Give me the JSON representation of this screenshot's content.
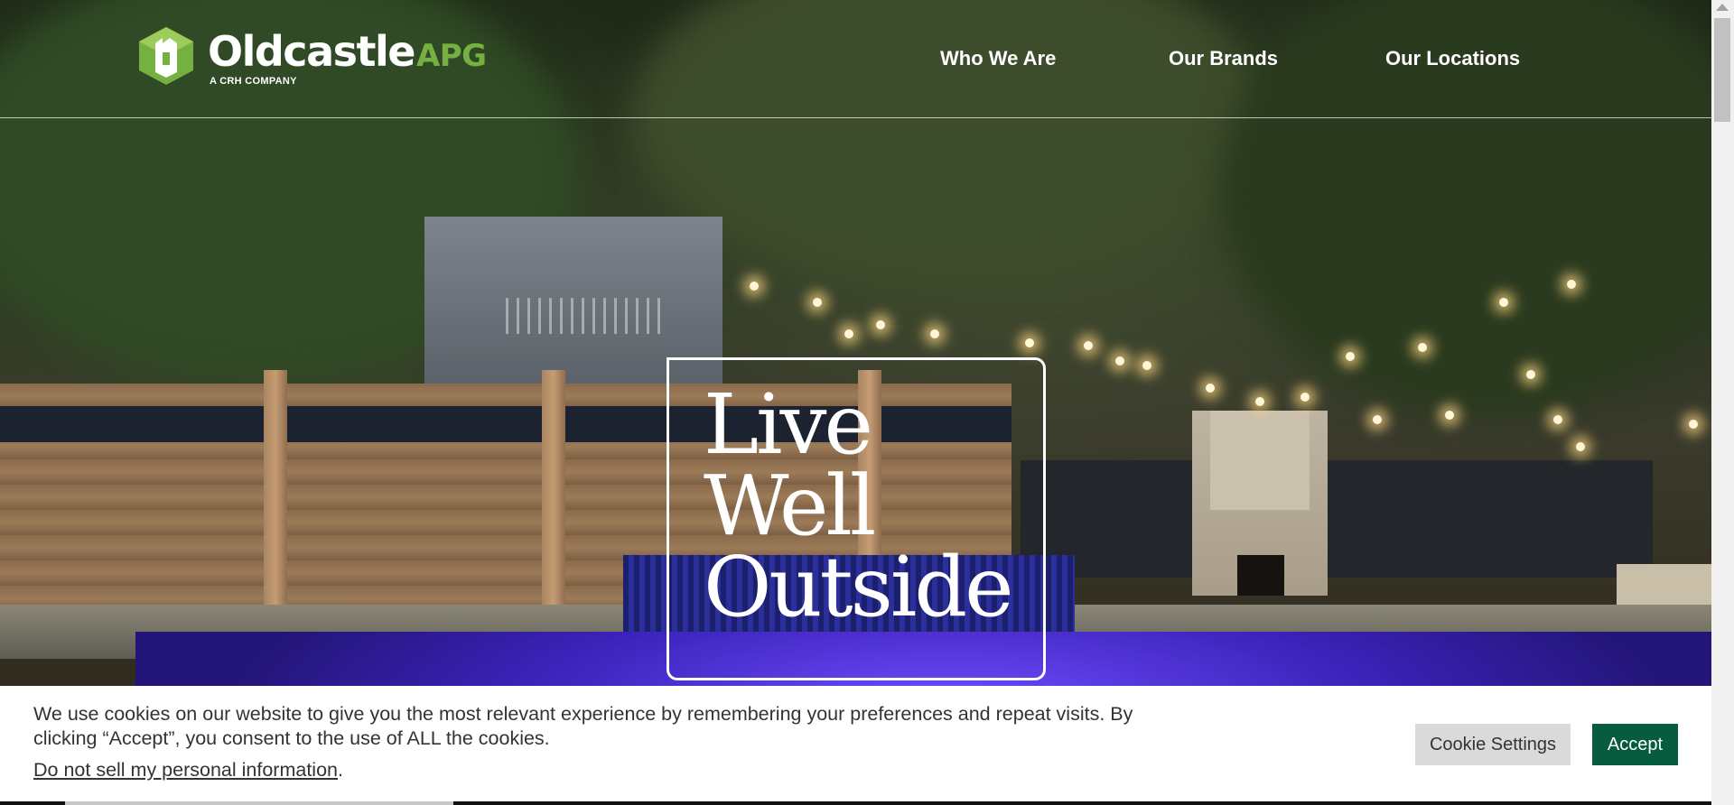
{
  "brand": {
    "name": "Oldcastle",
    "suffix": "APG",
    "tagline": "A CRH COMPANY",
    "accent_color": "#76b043"
  },
  "nav": {
    "items": [
      {
        "label": "Who We Are"
      },
      {
        "label": "Our Brands"
      },
      {
        "label": "Our Locations"
      }
    ]
  },
  "hero": {
    "lines": [
      "Live",
      "Well",
      "Outside"
    ]
  },
  "cookie": {
    "message": "We use cookies on our website to give you the most relevant experience by remembering your preferences and repeat visits. By clicking “Accept”, you consent to the use of ALL the cookies.",
    "link_text": "Do not sell my personal information",
    "link_suffix": ".",
    "settings_label": "Cookie Settings",
    "accept_label": "Accept",
    "accept_color": "#075b3f"
  }
}
